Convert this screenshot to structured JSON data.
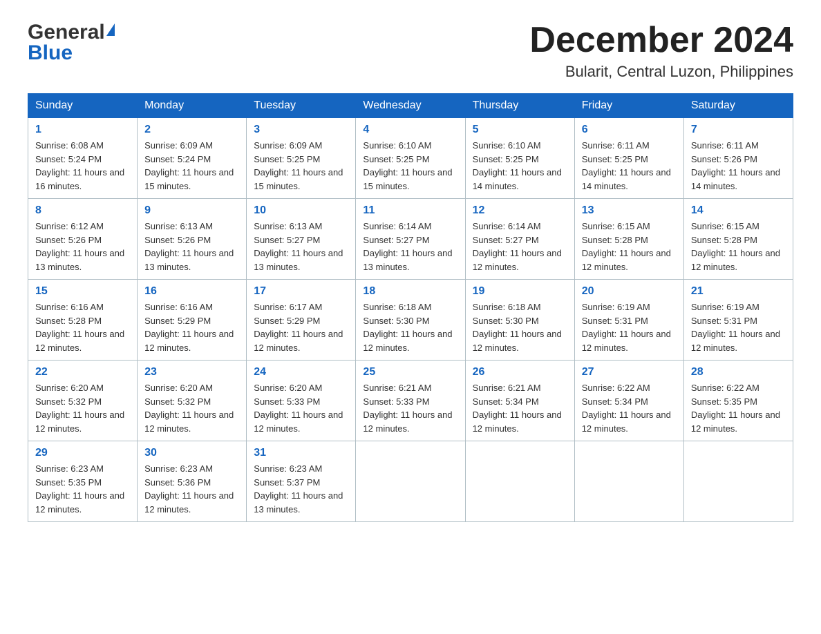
{
  "header": {
    "logo_general": "General",
    "logo_blue": "Blue",
    "month_title": "December 2024",
    "location": "Bularit, Central Luzon, Philippines"
  },
  "weekdays": [
    "Sunday",
    "Monday",
    "Tuesday",
    "Wednesday",
    "Thursday",
    "Friday",
    "Saturday"
  ],
  "weeks": [
    [
      {
        "day": "1",
        "sunrise": "6:08 AM",
        "sunset": "5:24 PM",
        "daylight": "11 hours and 16 minutes."
      },
      {
        "day": "2",
        "sunrise": "6:09 AM",
        "sunset": "5:24 PM",
        "daylight": "11 hours and 15 minutes."
      },
      {
        "day": "3",
        "sunrise": "6:09 AM",
        "sunset": "5:25 PM",
        "daylight": "11 hours and 15 minutes."
      },
      {
        "day": "4",
        "sunrise": "6:10 AM",
        "sunset": "5:25 PM",
        "daylight": "11 hours and 15 minutes."
      },
      {
        "day": "5",
        "sunrise": "6:10 AM",
        "sunset": "5:25 PM",
        "daylight": "11 hours and 14 minutes."
      },
      {
        "day": "6",
        "sunrise": "6:11 AM",
        "sunset": "5:25 PM",
        "daylight": "11 hours and 14 minutes."
      },
      {
        "day": "7",
        "sunrise": "6:11 AM",
        "sunset": "5:26 PM",
        "daylight": "11 hours and 14 minutes."
      }
    ],
    [
      {
        "day": "8",
        "sunrise": "6:12 AM",
        "sunset": "5:26 PM",
        "daylight": "11 hours and 13 minutes."
      },
      {
        "day": "9",
        "sunrise": "6:13 AM",
        "sunset": "5:26 PM",
        "daylight": "11 hours and 13 minutes."
      },
      {
        "day": "10",
        "sunrise": "6:13 AM",
        "sunset": "5:27 PM",
        "daylight": "11 hours and 13 minutes."
      },
      {
        "day": "11",
        "sunrise": "6:14 AM",
        "sunset": "5:27 PM",
        "daylight": "11 hours and 13 minutes."
      },
      {
        "day": "12",
        "sunrise": "6:14 AM",
        "sunset": "5:27 PM",
        "daylight": "11 hours and 12 minutes."
      },
      {
        "day": "13",
        "sunrise": "6:15 AM",
        "sunset": "5:28 PM",
        "daylight": "11 hours and 12 minutes."
      },
      {
        "day": "14",
        "sunrise": "6:15 AM",
        "sunset": "5:28 PM",
        "daylight": "11 hours and 12 minutes."
      }
    ],
    [
      {
        "day": "15",
        "sunrise": "6:16 AM",
        "sunset": "5:28 PM",
        "daylight": "11 hours and 12 minutes."
      },
      {
        "day": "16",
        "sunrise": "6:16 AM",
        "sunset": "5:29 PM",
        "daylight": "11 hours and 12 minutes."
      },
      {
        "day": "17",
        "sunrise": "6:17 AM",
        "sunset": "5:29 PM",
        "daylight": "11 hours and 12 minutes."
      },
      {
        "day": "18",
        "sunrise": "6:18 AM",
        "sunset": "5:30 PM",
        "daylight": "11 hours and 12 minutes."
      },
      {
        "day": "19",
        "sunrise": "6:18 AM",
        "sunset": "5:30 PM",
        "daylight": "11 hours and 12 minutes."
      },
      {
        "day": "20",
        "sunrise": "6:19 AM",
        "sunset": "5:31 PM",
        "daylight": "11 hours and 12 minutes."
      },
      {
        "day": "21",
        "sunrise": "6:19 AM",
        "sunset": "5:31 PM",
        "daylight": "11 hours and 12 minutes."
      }
    ],
    [
      {
        "day": "22",
        "sunrise": "6:20 AM",
        "sunset": "5:32 PM",
        "daylight": "11 hours and 12 minutes."
      },
      {
        "day": "23",
        "sunrise": "6:20 AM",
        "sunset": "5:32 PM",
        "daylight": "11 hours and 12 minutes."
      },
      {
        "day": "24",
        "sunrise": "6:20 AM",
        "sunset": "5:33 PM",
        "daylight": "11 hours and 12 minutes."
      },
      {
        "day": "25",
        "sunrise": "6:21 AM",
        "sunset": "5:33 PM",
        "daylight": "11 hours and 12 minutes."
      },
      {
        "day": "26",
        "sunrise": "6:21 AM",
        "sunset": "5:34 PM",
        "daylight": "11 hours and 12 minutes."
      },
      {
        "day": "27",
        "sunrise": "6:22 AM",
        "sunset": "5:34 PM",
        "daylight": "11 hours and 12 minutes."
      },
      {
        "day": "28",
        "sunrise": "6:22 AM",
        "sunset": "5:35 PM",
        "daylight": "11 hours and 12 minutes."
      }
    ],
    [
      {
        "day": "29",
        "sunrise": "6:23 AM",
        "sunset": "5:35 PM",
        "daylight": "11 hours and 12 minutes."
      },
      {
        "day": "30",
        "sunrise": "6:23 AM",
        "sunset": "5:36 PM",
        "daylight": "11 hours and 12 minutes."
      },
      {
        "day": "31",
        "sunrise": "6:23 AM",
        "sunset": "5:37 PM",
        "daylight": "11 hours and 13 minutes."
      },
      null,
      null,
      null,
      null
    ]
  ]
}
